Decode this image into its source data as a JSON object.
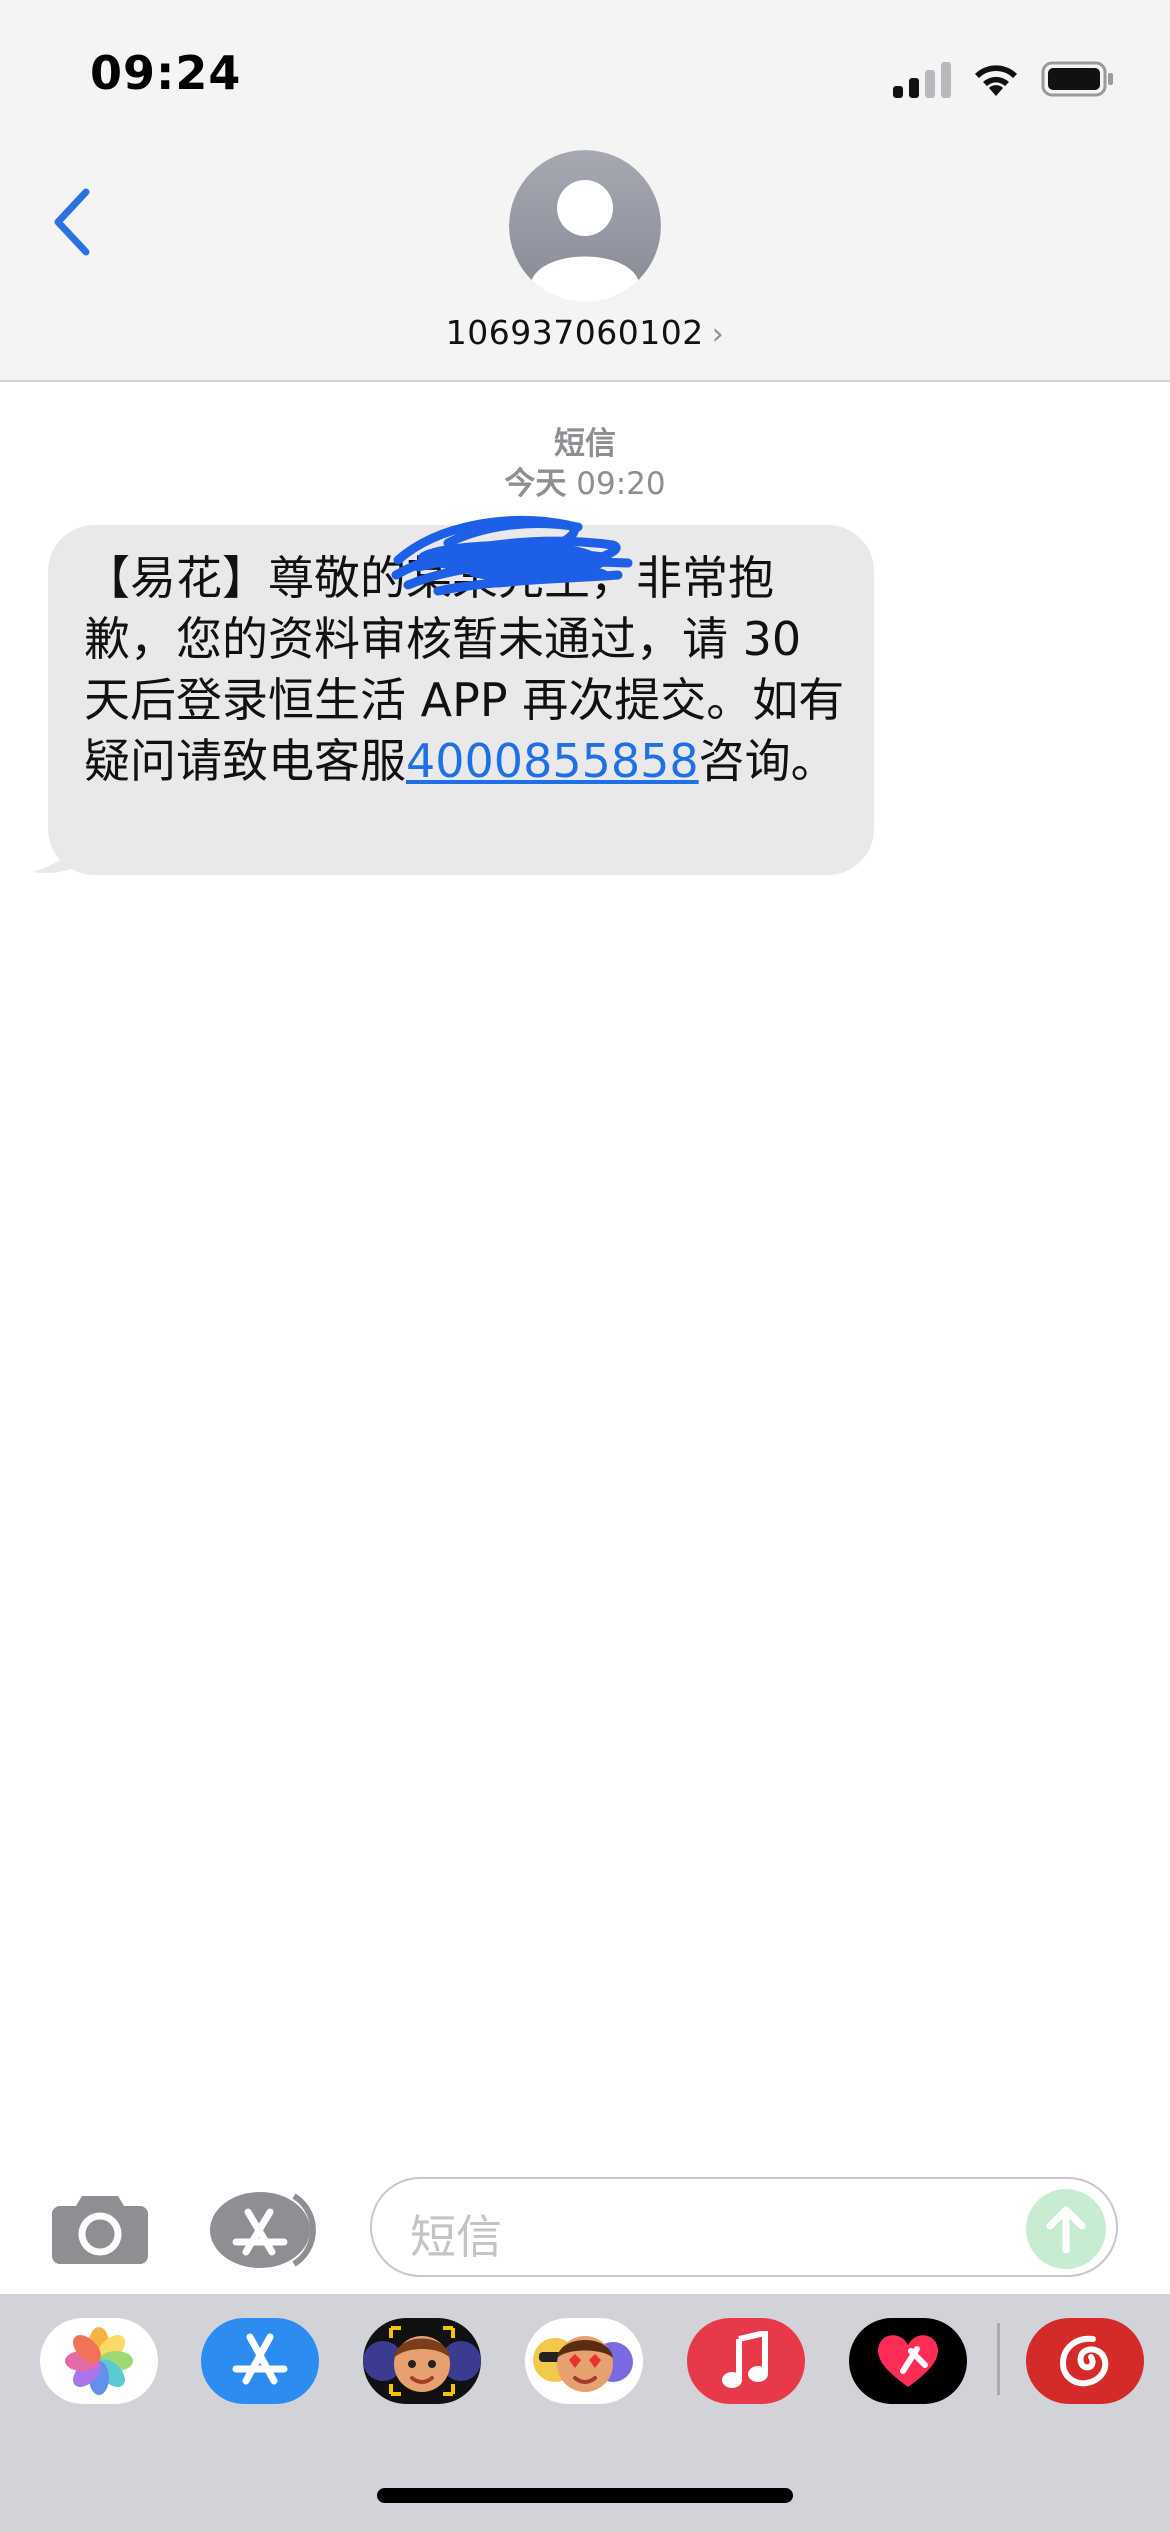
{
  "status_bar": {
    "time": "09:24",
    "icons": [
      "cellular-signal-icon",
      "wifi-icon",
      "battery-icon"
    ]
  },
  "header": {
    "back_icon": "chevron-left-icon",
    "contact_number": "106937060102",
    "contact_chevron": "›",
    "avatar_icon": "person-icon"
  },
  "thread": {
    "service_label": "短信",
    "timestamp_day": "今天",
    "timestamp_time": "09:20",
    "message": {
      "text_before_link": "【易花】尊敬的某某先生，非常抱歉，您的资料审核暂未通过，请 30 天后登录恒生活 APP 再次提交。如有疑问请致电客服",
      "phone_link": "4000855858",
      "text_after_link": "咨询。"
    }
  },
  "input_bar": {
    "camera_icon": "camera-icon",
    "apps_icon": "app-store-icon",
    "placeholder": "短信",
    "send_icon": "arrow-up-icon"
  },
  "app_drawer": {
    "apps": [
      {
        "name": "photos-icon"
      },
      {
        "name": "app-store-icon"
      },
      {
        "name": "memoji-icon"
      },
      {
        "name": "memoji-stickers-icon"
      },
      {
        "name": "music-icon"
      },
      {
        "name": "digital-touch-icon"
      },
      {
        "name": "netease-music-icon"
      }
    ]
  },
  "colors": {
    "accent_blue": "#2a72e0",
    "bubble_gray": "#e9e9eb",
    "send_green": "#c8ecd2",
    "redaction_blue": "#1e5fe8"
  }
}
